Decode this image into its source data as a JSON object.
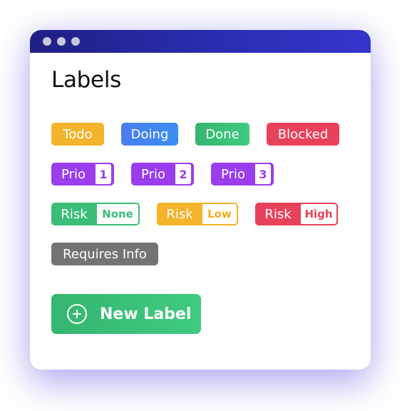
{
  "window": {
    "title": "Labels",
    "titlebar_color": "#2b2db0"
  },
  "status_labels": [
    {
      "text": "Todo",
      "color": "#f3b32b"
    },
    {
      "text": "Doing",
      "color": "#4a85f0"
    },
    {
      "text": "Done",
      "color": "#3bbd78"
    },
    {
      "text": "Blocked",
      "color": "#e8415a"
    }
  ],
  "priority_labels": [
    {
      "text": "Prio",
      "value": "1",
      "color": "#9b3ded"
    },
    {
      "text": "Prio",
      "value": "2",
      "color": "#9b3ded"
    },
    {
      "text": "Prio",
      "value": "3",
      "color": "#9b3ded"
    }
  ],
  "risk_labels": [
    {
      "text": "Risk",
      "value": "None",
      "color": "#3bbd78"
    },
    {
      "text": "Risk",
      "value": "Low",
      "color": "#f3b32b"
    },
    {
      "text": "Risk",
      "value": "High",
      "color": "#e8415a"
    }
  ],
  "other_labels": [
    {
      "text": "Requires Info",
      "color": "#737373"
    }
  ],
  "actions": {
    "new_label": "New Label",
    "new_label_icon": "plus-circle-icon"
  }
}
